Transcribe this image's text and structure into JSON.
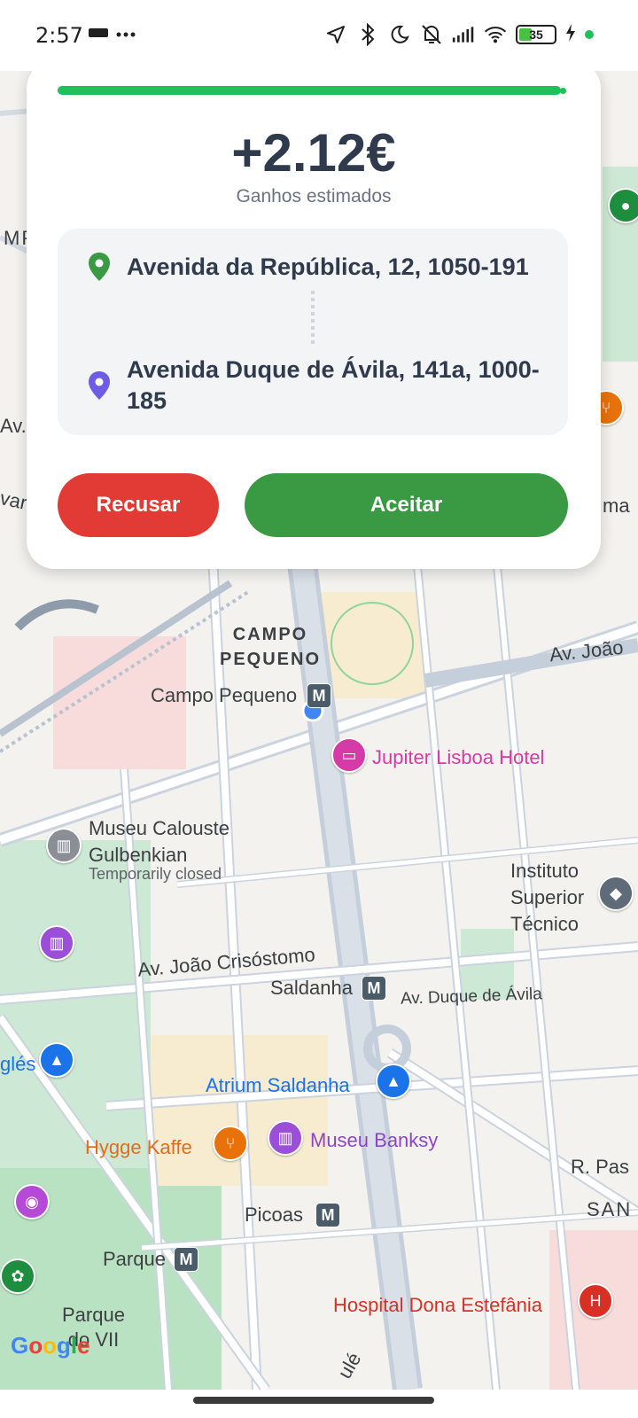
{
  "status_bar": {
    "time": "2:57",
    "battery": "35",
    "icons": [
      "sim-icon",
      "more-dots-icon",
      "location-icon",
      "bluetooth-icon",
      "moon-icon",
      "mute-icon",
      "signal-icon",
      "wifi-icon",
      "battery-icon",
      "charging-icon"
    ]
  },
  "offer": {
    "progress_fraction": 0.99,
    "earnings": "+2.12€",
    "earnings_label": "Ganhos estimados",
    "pickup": {
      "address": "Avenida da República, 12, 1050-191",
      "icon": "pickup-pin-icon",
      "color": "#3a9a44"
    },
    "dropoff": {
      "address": "Avenida Duque de Ávila, 141a, 1000-185",
      "icon": "dropoff-pin-icon",
      "color": "#6f5ce6"
    },
    "refuse_label": "Recusar",
    "accept_label": "Aceitar"
  },
  "map": {
    "district": "CAMPO\nPEQUENO",
    "labels": {
      "campo_pequeno": "Campo Pequeno",
      "jupiter": "Jupiter Lisboa Hotel",
      "gulbenkian": "Museu Calouste\nGulbenkian",
      "gulbenkian_status": "Temporarily closed",
      "instituto": "Instituto\nSuperior\nTécnico",
      "av_joao_crisostomo": "Av. João Crisóstomo",
      "saldanha": "Saldanha",
      "av_duque_avila": "Av. Duque de Ávila",
      "atrium": "Atrium Saldanha",
      "hygge": "Hygge Kaffe",
      "banksy": "Museu Banksy",
      "picoas": "Picoas",
      "parque": "Parque",
      "parque_eduardo": "Parque\ndo VII",
      "hospital": "Hospital Dona Estefânia",
      "av_joao": "Av. João",
      "r_pas": "R. Pas",
      "san": "SAN",
      "gles": "glés",
      "av_left": "Av.",
      "var_left": "var",
      "mp_left": "MP",
      "ma_right": "ma",
      "ule": "ulé"
    },
    "brand": "Google"
  }
}
